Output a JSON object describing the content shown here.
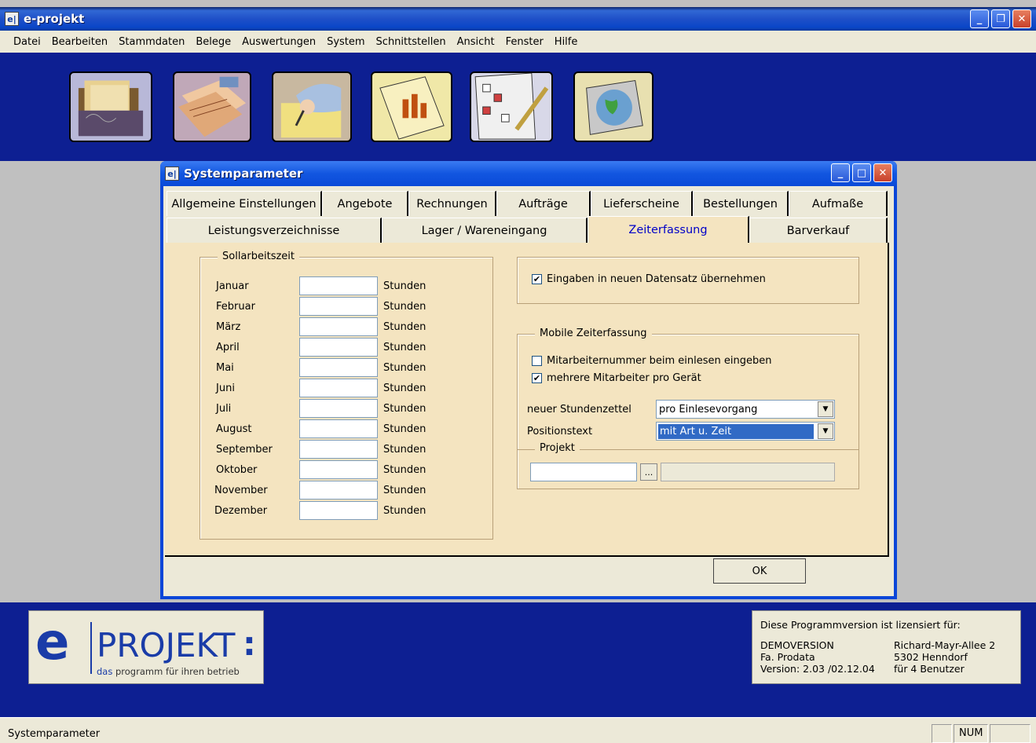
{
  "app": {
    "icon_text": "e|",
    "title": "e-projekt"
  },
  "window_controls": {
    "minimize": "_",
    "restore": "❐",
    "close": "✕"
  },
  "menu": [
    "Datei",
    "Bearbeiten",
    "Stammdaten",
    "Belege",
    "Auswertungen",
    "System",
    "Schnittstellen",
    "Ansicht",
    "Fenster",
    "Hilfe"
  ],
  "toolbar_icons": [
    "archive-folders-icon",
    "papers-stack-icon",
    "writing-hand-icon",
    "bar-chart-document-icon",
    "checklist-pen-icon",
    "globe-monitor-icon"
  ],
  "dialog": {
    "title": "Systemparameter",
    "tabs_row1": [
      "Allgemeine Einstellungen",
      "Angebote",
      "Rechnungen",
      "Aufträge",
      "Lieferscheine",
      "Bestellungen",
      "Aufmaße"
    ],
    "tabs_row2": [
      "Leistungsverzeichnisse",
      "Lager / Wareneingang",
      "Zeiterfassung",
      "Barverkauf"
    ],
    "active_tab": "Zeiterfassung",
    "sollarbeitszeit": {
      "legend": "Sollarbeitszeit",
      "unit": "Stunden",
      "months": [
        "Januar",
        "Februar",
        "März",
        "April",
        "Mai",
        "Juni",
        "Juli",
        "August",
        "September",
        "Oktober",
        "November",
        "Dezember"
      ]
    },
    "eingaben_checkbox": {
      "label": "Eingaben in neuen Datensatz übernehmen",
      "checked": true
    },
    "mobile": {
      "legend": "Mobile Zeiterfassung",
      "cb_mitarbeiternummer": {
        "label": "Mitarbeiternummer beim einlesen eingeben",
        "checked": false
      },
      "cb_mehrere": {
        "label": "mehrere Mitarbeiter pro Gerät",
        "checked": true
      },
      "neuer_stundenzettel_label": "neuer Stundenzettel",
      "neuer_stundenzettel_value": "pro Einlesevorgang",
      "positionstext_label": "Positionstext",
      "positionstext_value": "mit Art u. Zeit",
      "projekt_legend": "Projekt",
      "browse_label": "..."
    },
    "ok_label": "OK"
  },
  "logo": {
    "letter": "e",
    "word": "PROJEKT",
    "colon": ":",
    "tagline_das": "das",
    "tagline_rest": " programm für ihren betrieb"
  },
  "license": {
    "header": "Diese Programmversion ist lizensiert für:",
    "left": [
      "DEMOVERSION",
      "Fa. Prodata",
      "Version: 2.03 /02.12.04"
    ],
    "right": [
      "Richard-Mayr-Allee 2",
      "5302 Henndorf",
      "für 4 Benutzer"
    ]
  },
  "statusbar": {
    "text": "Systemparameter",
    "num": "NUM"
  }
}
